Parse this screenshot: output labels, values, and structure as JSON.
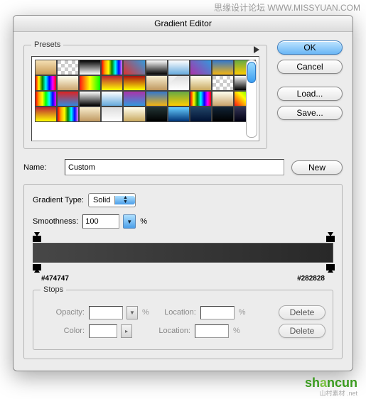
{
  "watermark_top": "思缘设计论坛  WWW.MISSYUAN.COM",
  "dialog": {
    "title": "Gradient Editor"
  },
  "buttons": {
    "ok": "OK",
    "cancel": "Cancel",
    "load": "Load...",
    "save": "Save...",
    "new": "New",
    "delete": "Delete"
  },
  "presets": {
    "legend": "Presets",
    "swatches": [
      "linear-gradient(#f5e0b5,#c89a55)",
      "repeating-conic-gradient(#ccc 0 25%,#fff 0 50%) 0/10px 10px",
      "linear-gradient(#000,#fff)",
      "linear-gradient(to right,red,orange,yellow,green,cyan,blue,violet)",
      "linear-gradient(45deg,#d33,#39d)",
      "linear-gradient(#fff,#000)",
      "linear-gradient(#fff,#6ad)",
      "linear-gradient(45deg,#a3a,#39d)",
      "linear-gradient(#37c,#f4b511)",
      "linear-gradient(#6a4,#fc0)",
      "linear-gradient(to right,red,yellow,green,cyan,blue,magenta,red)",
      "linear-gradient(#ffe,#caa46c)",
      "linear-gradient(to right,#f11,#ff0,#0f0)",
      "linear-gradient(#b23,#ff0)",
      "linear-gradient(#a11,#ff0)",
      "linear-gradient(#f7edcf,#bf9860)",
      "linear-gradient(135deg,#eee 25%,transparent 25%),linear-gradient(#ddd,#fff)",
      "linear-gradient(#ffe,#c9a95f)",
      "repeating-conic-gradient(#ccc 0 25%,#fff 0 50%) 0/10px 10px",
      "linear-gradient(#fff,#000)",
      "linear-gradient(to right,red,orange,yellow,lime,cyan,blue,magenta)",
      "linear-gradient(#d22,#38d)",
      "linear-gradient(#fff,#000)",
      "linear-gradient(#fff,#6ad)",
      "linear-gradient(#a3a,#39d)",
      "linear-gradient(#37c,#f4b511)",
      "linear-gradient(#6a4,#fc0)",
      "linear-gradient(to right,red,yellow,green,cyan,blue,magenta,red)",
      "linear-gradient(#ffe,#caa46c)",
      "linear-gradient(45deg,#f11,#ff0,#0f0)",
      "linear-gradient(#b23,#ff0)",
      "linear-gradient(to right,red,orange,yellow,green,cyan,blue,violet)",
      "linear-gradient(#f7edcf,#bf9860)",
      "linear-gradient(#ddd,#fff)",
      "linear-gradient(#ffe,#c9a95f)",
      "linear-gradient(#233,#000)",
      "linear-gradient(#6cf,#037)",
      "linear-gradient(#246,#013)",
      "linear-gradient(#123,#000)",
      "linear-gradient(#335,#001)"
    ]
  },
  "name": {
    "label": "Name:",
    "value": "Custom"
  },
  "gradient_type": {
    "label": "Gradient Type:",
    "value": "Solid"
  },
  "smoothness": {
    "label": "Smoothness:",
    "value": "100",
    "unit": "%"
  },
  "gradient": {
    "left_hex": "#474747",
    "right_hex": "#282828"
  },
  "stops": {
    "legend": "Stops",
    "opacity_label": "Opacity:",
    "opacity_unit": "%",
    "location_label": "Location:",
    "location_unit": "%",
    "color_label": "Color:"
  },
  "logo": {
    "text_a": "sh",
    "text_b": "a",
    "text_c": "ncun",
    "sub": "山村素材  .net"
  }
}
